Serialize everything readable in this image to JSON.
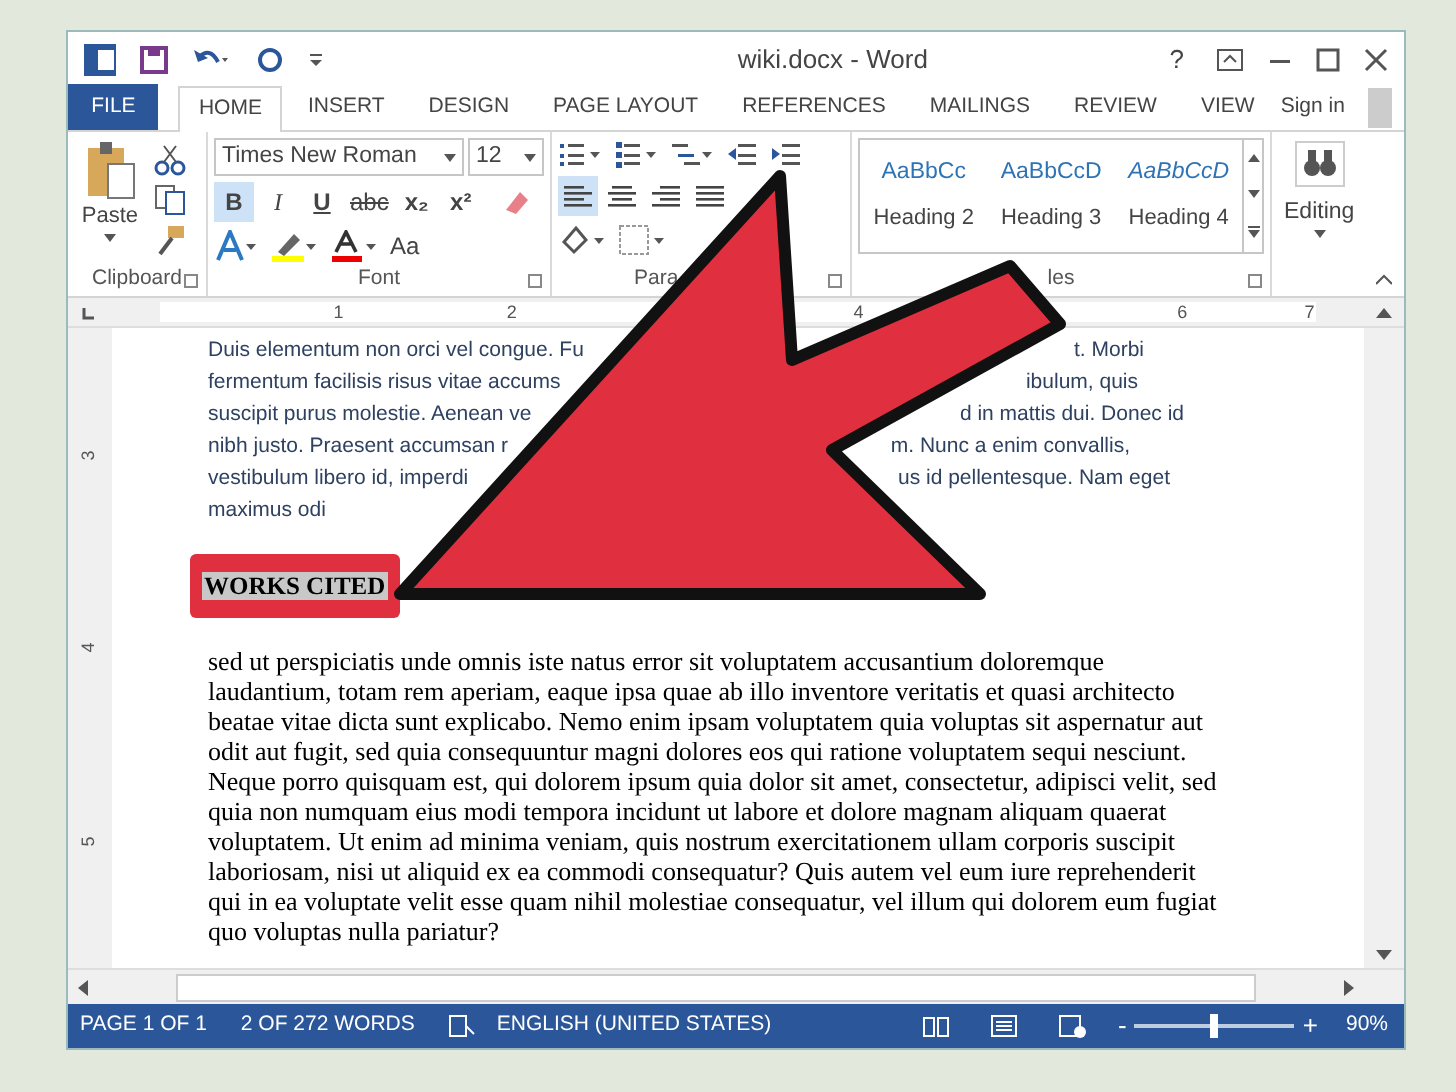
{
  "window": {
    "title": "wiki.docx - Word",
    "help": "?"
  },
  "tabs": [
    {
      "label": "FILE",
      "kind": "file",
      "selected": false
    },
    {
      "label": "HOME",
      "kind": "tab",
      "selected": true
    },
    {
      "label": "INSERT",
      "kind": "tab",
      "selected": false
    },
    {
      "label": "DESIGN",
      "kind": "tab",
      "selected": false
    },
    {
      "label": "PAGE LAYOUT",
      "kind": "tab",
      "selected": false
    },
    {
      "label": "REFERENCES",
      "kind": "tab",
      "selected": false
    },
    {
      "label": "MAILINGS",
      "kind": "tab",
      "selected": false
    },
    {
      "label": "REVIEW",
      "kind": "tab",
      "selected": false
    },
    {
      "label": "VIEW",
      "kind": "tab",
      "selected": false
    }
  ],
  "sign_in": "Sign in",
  "ribbon": {
    "clipboard": {
      "paste": "Paste",
      "label": "Clipboard"
    },
    "font": {
      "name": "Times New Roman",
      "size": "12",
      "label": "Font",
      "change_case": "Aa",
      "format_buttons": [
        {
          "label": "B",
          "kind": "bold",
          "selected": true
        },
        {
          "label": "I",
          "kind": "italic",
          "selected": false
        },
        {
          "label": "U",
          "kind": "underline",
          "selected": false
        },
        {
          "label": "abc",
          "kind": "strike",
          "selected": false
        },
        {
          "label": "x₂",
          "kind": "plain",
          "selected": false
        },
        {
          "label": "x²",
          "kind": "plain",
          "selected": false
        }
      ]
    },
    "paragraph": {
      "label": "Para",
      "alignment": [
        {
          "kind": "left",
          "selected": true
        },
        {
          "kind": "center",
          "selected": false
        },
        {
          "kind": "right",
          "selected": false
        },
        {
          "kind": "justify",
          "selected": false
        }
      ]
    },
    "styles": {
      "label": "les",
      "items": [
        {
          "preview": "AaBbCc",
          "name": "Heading 2",
          "italic": false
        },
        {
          "preview": "AaBbCcD",
          "name": "Heading 3",
          "italic": false
        },
        {
          "preview": "AaBbCcD",
          "name": "Heading 4",
          "italic": true
        }
      ]
    },
    "editing": {
      "label": "Editing"
    }
  },
  "ruler": {
    "numbers": [
      "1",
      "2",
      "4",
      "6",
      "7"
    ],
    "vertical_numbers": [
      "3",
      "4",
      "5"
    ]
  },
  "document": {
    "top_lines": [
      {
        "left": "Duis elementum non orci vel congue. Fu",
        "right": "t. Morbi"
      },
      {
        "left": "fermentum facilisis risus vitae accums",
        "right": "ibulum, quis"
      },
      {
        "left": "suscipit purus molestie. Aenean ve",
        "right": "d in mattis dui. Donec id"
      },
      {
        "left": "nibh justo. Praesent accumsan r",
        "right": "m. Nunc a enim convallis,"
      },
      {
        "left": "vestibulum libero id, imperdi",
        "right": "us id pellentesque. Nam eget"
      },
      {
        "left": "maximus odi"
      }
    ],
    "heading": {
      "text": "WORKS CITED",
      "selected": true
    },
    "body": "sed ut perspiciatis unde omnis iste natus error sit voluptatem accusantium doloremque laudantium, totam rem aperiam, eaque ipsa quae ab illo inventore veritatis et quasi architecto beatae vitae dicta sunt explicabo. Nemo enim ipsam voluptatem quia voluptas sit aspernatur aut odit aut fugit, sed quia consequuntur magni dolores eos qui ratione voluptatem sequi nesciunt. Neque porro quisquam est, qui dolorem ipsum quia dolor sit amet, consectetur, adipisci velit, sed quia non numquam eius modi tempora incidunt ut labore et dolore magnam aliquam quaerat voluptatem. Ut enim ad minima veniam, quis nostrum exercitationem ullam corporis suscipit laboriosam, nisi ut aliquid ex ea commodi consequatur? Quis autem vel eum iure reprehenderit qui in ea voluptate velit esse quam nihil molestiae consequatur, vel illum qui dolorem eum fugiat quo voluptas nulla pariatur?"
  },
  "status_bar": {
    "page": "PAGE 1 OF 1",
    "words": "2 OF 272 WORDS",
    "language": "ENGLISH (UNITED STATES)",
    "zoom_out": "-",
    "zoom_in": "+",
    "zoom": {
      "level": 0.5
    },
    "zoom_reading": "90%"
  }
}
